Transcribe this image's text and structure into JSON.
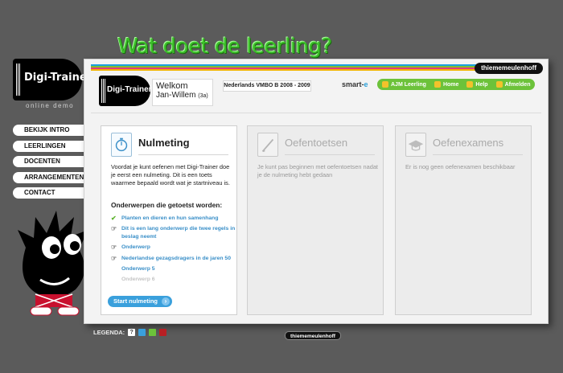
{
  "headline": "Wat doet de leerling?",
  "left": {
    "logo_text": "Digi-Trainer",
    "logo_sub": "online demo",
    "nav": [
      "BEKIJK INTRO",
      "LEERLINGEN",
      "DOCENTEN",
      "ARRANGEMENTEN",
      "CONTACT"
    ]
  },
  "header": {
    "brand": "thiememeulenhoff",
    "logo_text": "Digi-Trainer",
    "welcome_line1": "Welkom",
    "welcome_name": "Jan-Willem",
    "welcome_class": "(3a)",
    "course": "Nederlands VMBO B 2008 - 2009",
    "smarte_prefix": "smart-",
    "smarte_suffix": "e",
    "nav": [
      "AJM Leerling",
      "Home",
      "Help",
      "Afmelden"
    ]
  },
  "cards": {
    "nulmeting": {
      "title": "Nulmeting",
      "body": "Voordat je kunt oefenen met Digi-Trainer doe je eerst een nulmeting. Dit is een toets waarmee bepaald wordt wat je startniveau is.",
      "subhead": "Onderwerpen die getoetst worden:",
      "topics": [
        "Planten en dieren en hun samenhang",
        "Dit is een lang onderwerp die twee regels in beslag neemt",
        "Onderwerp",
        "Nederlandse gezagsdragers in de jaren 50",
        "Onderwerp 5",
        "Onderwerp 6"
      ],
      "start_label": "Start nulmeting",
      "start_chevron": "›"
    },
    "oefentoetsen": {
      "title": "Oefentoetsen",
      "body": "Je kunt pas beginnen met oefentoetsen nadat je de nulmeting hebt gedaan"
    },
    "oefenexamens": {
      "title": "Oefenexamens",
      "body": "Er is  nog geen oefenexamen beschikbaar"
    }
  },
  "legend": {
    "label": "LEGENDA:",
    "help_glyph": "?",
    "colors": [
      "#3aa0dc",
      "#6cc23a",
      "#b81f24"
    ]
  },
  "footer_brand": "thiememeulenhoff",
  "colors": {
    "accent_green": "#3cbf2a",
    "nav_green": "#6cc23a",
    "link_blue": "#3a8fc8"
  }
}
